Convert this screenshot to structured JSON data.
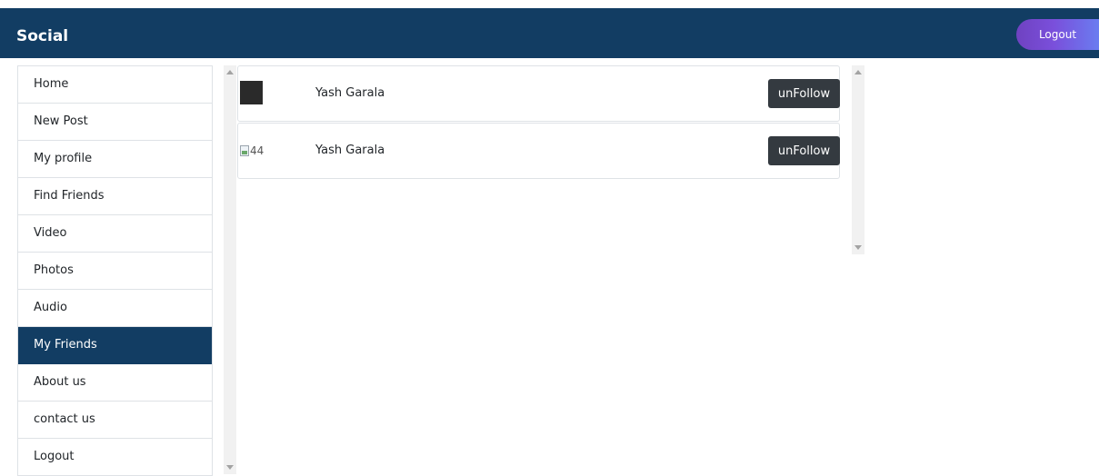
{
  "navbar": {
    "brand": "Social",
    "logout_label": "Logout"
  },
  "sidebar": {
    "items": [
      {
        "label": "Home",
        "active": false
      },
      {
        "label": "New Post",
        "active": false
      },
      {
        "label": "My profile",
        "active": false
      },
      {
        "label": "Find Friends",
        "active": false
      },
      {
        "label": "Video",
        "active": false
      },
      {
        "label": "Photos",
        "active": false
      },
      {
        "label": "Audio",
        "active": false
      },
      {
        "label": "My Friends",
        "active": true
      },
      {
        "label": "About us",
        "active": false
      },
      {
        "label": "contact us",
        "active": false
      },
      {
        "label": "Logout",
        "active": false
      }
    ]
  },
  "friends": [
    {
      "name": "Yash Garala",
      "avatar_alt": "",
      "button_label": "unFollow"
    },
    {
      "name": "Yash Garala",
      "avatar_alt": "44",
      "button_label": "unFollow"
    }
  ],
  "colors": {
    "navbar_bg": "#123d63",
    "active_item_bg": "#123d63",
    "button_dark": "#343a40",
    "logout_gradient_start": "#6f42c1",
    "logout_gradient_end": "#6a7cf0"
  }
}
